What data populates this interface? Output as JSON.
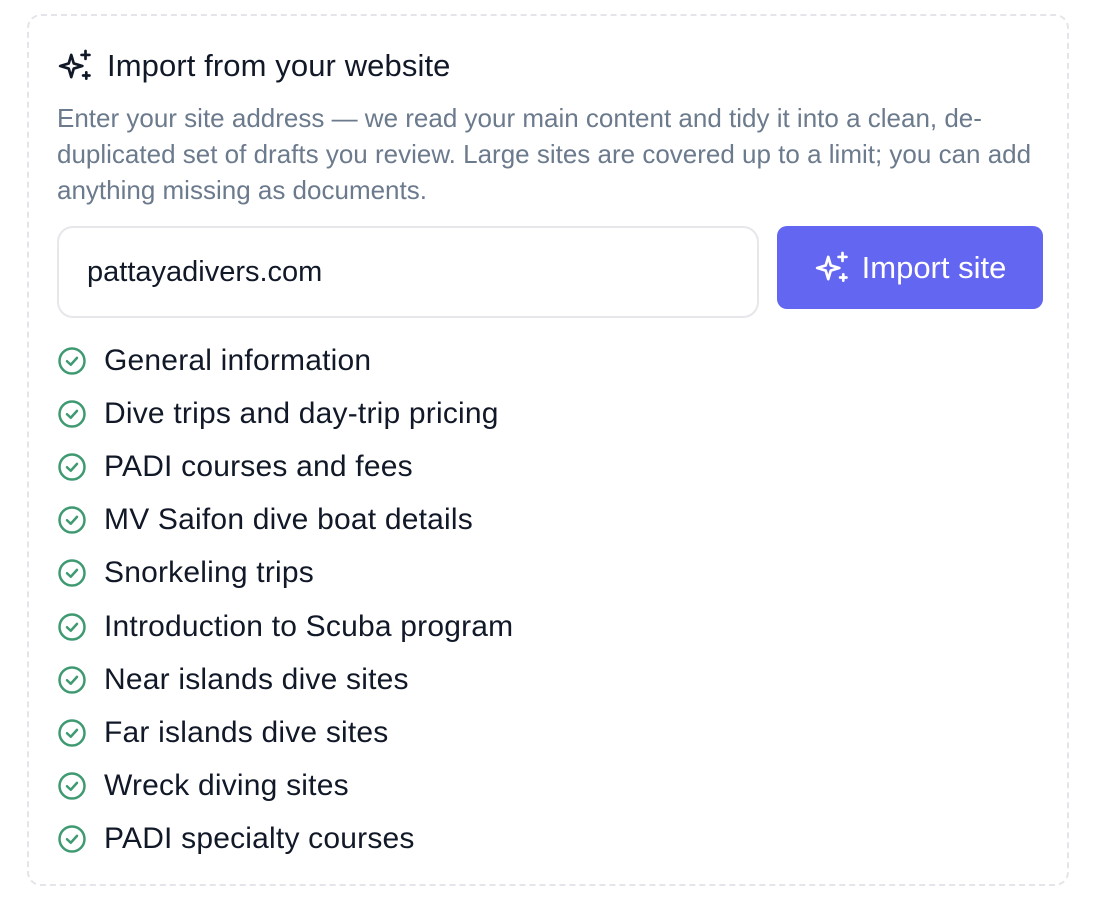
{
  "panel": {
    "title": "Import from your website",
    "header_icon": "sparkles-icon",
    "description": "Enter your site address — we read your main content and tidy it into a clean, de-duplicated set of drafts you review. Large sites are covered up to a limit; you can add anything missing as documents."
  },
  "url_input": {
    "value": "pattayadivers.com"
  },
  "import_button": {
    "label": "Import site",
    "icon": "sparkles-icon",
    "color": "#6366f1"
  },
  "pages": {
    "check_icon": "check-circle-icon",
    "check_color": "#3f9a72",
    "items": [
      {
        "label": "General information"
      },
      {
        "label": "Dive trips and day-trip pricing"
      },
      {
        "label": "PADI courses and fees"
      },
      {
        "label": "MV Saifon dive boat details"
      },
      {
        "label": "Snorkeling trips"
      },
      {
        "label": "Introduction to Scuba program"
      },
      {
        "label": "Near islands dive sites"
      },
      {
        "label": "Far islands dive sites"
      },
      {
        "label": "Wreck diving sites"
      },
      {
        "label": "PADI specialty courses"
      }
    ]
  }
}
